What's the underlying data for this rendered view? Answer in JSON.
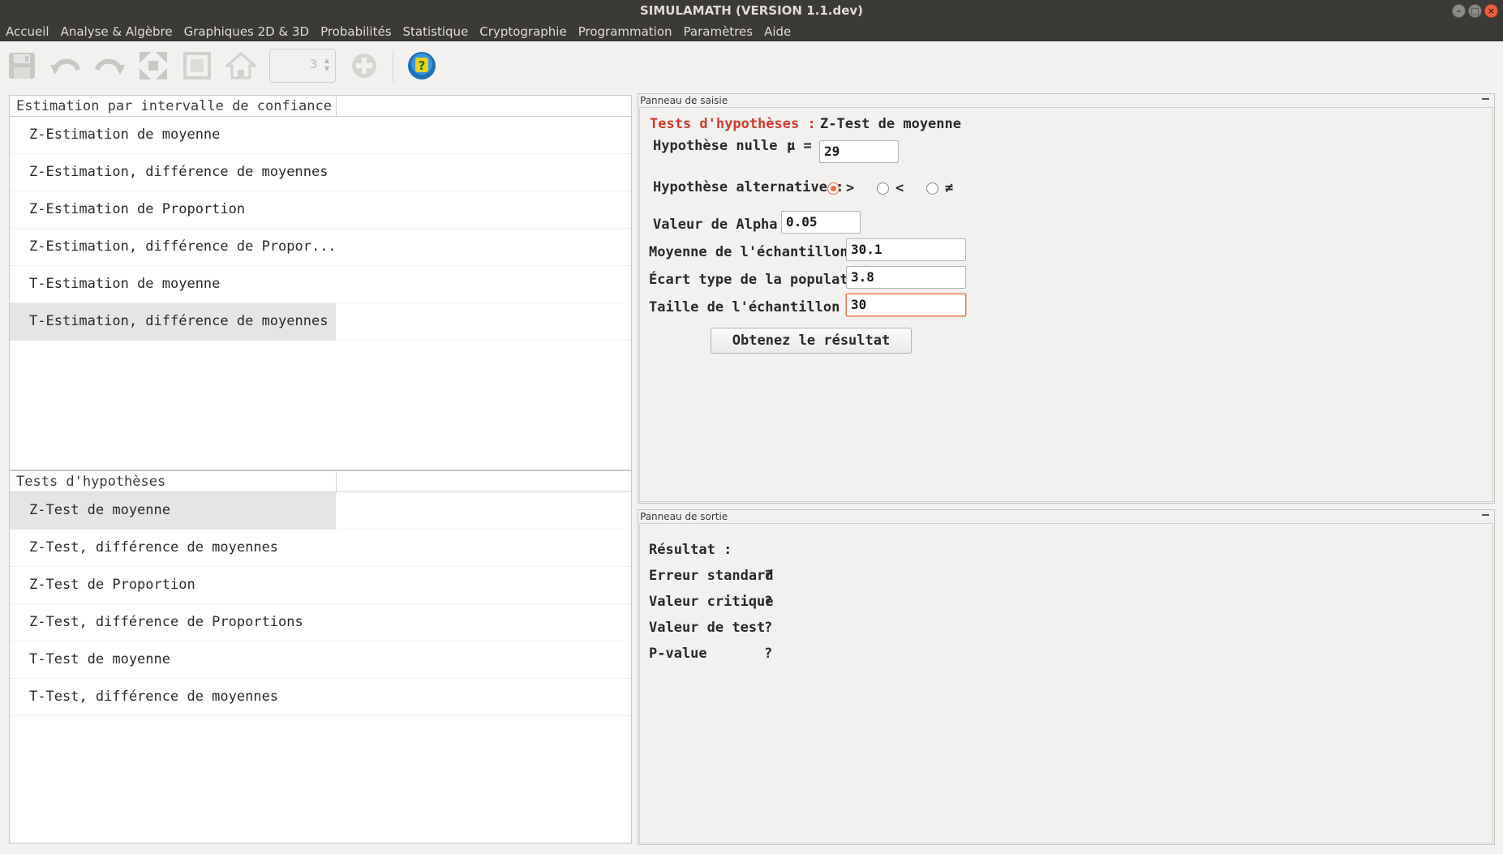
{
  "window": {
    "title": "SIMULAMATH   (VERSION 1.1.dev)",
    "controls": [
      "minimize-icon",
      "maximize-icon",
      "close-icon"
    ]
  },
  "menu": [
    "Accueil",
    "Analyse & Algèbre",
    "Graphiques 2D & 3D",
    "Probabilités",
    "Statistique",
    "Cryptographie",
    "Programmation",
    "Paramètres",
    "Aide"
  ],
  "toolbar": {
    "icons": [
      "save-icon",
      "undo-icon",
      "redo-icon",
      "expand-icon",
      "fit-icon",
      "home-icon"
    ],
    "spin_value": "3",
    "extra_icons": [
      "add-icon",
      "help-icon"
    ]
  },
  "sections": {
    "confidence": {
      "header": "Estimation par intervalle de confiance",
      "items": [
        "Z-Estimation de moyenne",
        "Z-Estimation, différence de moyennes",
        "Z-Estimation de Proportion",
        "Z-Estimation, différence de Propor...",
        "T-Estimation de moyenne",
        "T-Estimation, différence de moyennes"
      ]
    },
    "tests": {
      "header": "Tests d'hypothèses",
      "items": [
        "Z-Test de moyenne",
        "Z-Test, différence de moyennes",
        "Z-Test de Proportion",
        "Z-Test, différence de Proportions",
        "T-Test de moyenne",
        "T-Test, différence de moyennes"
      ]
    }
  },
  "input_panel": {
    "dock_title": "Panneau de saisie",
    "heading_prefix": "Tests d'hypothèses :",
    "heading_title": "Z-Test de moyenne",
    "null_hypothesis_label": "Hypothèse nulle :",
    "mu_label": "μ =",
    "mu_value": "29",
    "alt_hypothesis_label": "Hypothèse alternative :",
    "alt_options": [
      ">",
      "<",
      "≠"
    ],
    "alt_selected": ">",
    "alpha_label": "Valeur de Alpha :",
    "alpha_value": "0.05",
    "sample_mean_label": "Moyenne de l'échantillon",
    "sample_mean_value": "30.1",
    "pop_sd_label": "Écart type de la population",
    "pop_sd_value": "3.8",
    "sample_size_label": "Taille de l'échantillon",
    "sample_size_value": "30",
    "submit_label": "Obtenez le résultat"
  },
  "output_panel": {
    "dock_title": "Panneau de sortie",
    "result_label": "Résultat :",
    "rows": [
      {
        "label": "Erreur standard",
        "value": "?"
      },
      {
        "label": "Valeur critique",
        "value": "?"
      },
      {
        "label": "Valeur de test",
        "value": "?"
      },
      {
        "label": "P-value",
        "value": "?"
      }
    ]
  }
}
